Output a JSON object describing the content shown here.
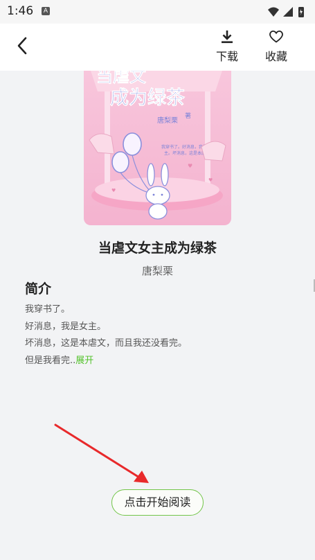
{
  "status_bar": {
    "time": "1:46",
    "badge": "A"
  },
  "top_bar": {
    "back_icon": "chevron-left-icon",
    "download_label": "下载",
    "download_icon": "download-icon",
    "collect_label": "收藏",
    "collect_icon": "heart-icon"
  },
  "cover": {
    "title_top": "当虐文",
    "title_main": "成为绿茶",
    "author": "唐梨栗",
    "author_suffix": "著",
    "blurb_1": "我穿书了。好消息，我是女",
    "blurb_2": "主。坏消息，这是本虐文"
  },
  "book": {
    "title": "当虐文女主成为绿茶",
    "author": "唐梨栗"
  },
  "intro": {
    "heading": "简介",
    "line_1": "我穿书了。",
    "line_2": "好消息，我是女主。",
    "line_3": "坏消息，这是本虐文，而且我还没看完。",
    "line_4": "但是我看完..",
    "expand": "展开"
  },
  "read_button": {
    "label": "点击开始阅读"
  },
  "colors": {
    "accent_green": "#53c22b",
    "button_border": "#72c548",
    "arrow_red": "#e8292b"
  }
}
